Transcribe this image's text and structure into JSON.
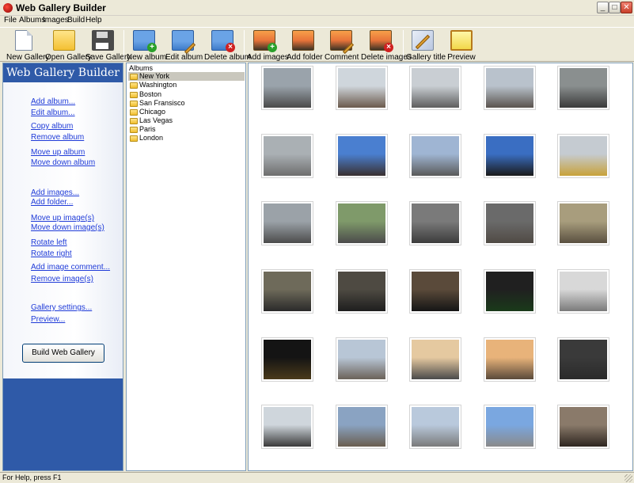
{
  "window": {
    "title": "Web Gallery Builder",
    "controls": [
      "_",
      "□",
      "✕"
    ]
  },
  "menu": [
    "File",
    "Albums",
    "Images",
    "Build",
    "Help"
  ],
  "toolbar": [
    {
      "label": "New Gallery",
      "icon": "new-document-icon"
    },
    {
      "label": "Open Gallery",
      "icon": "open-folder-icon"
    },
    {
      "label": "Save Gallery",
      "icon": "floppy-disk-icon"
    },
    {
      "label": "New album",
      "icon": "new-album-icon"
    },
    {
      "label": "Edit album",
      "icon": "edit-album-icon"
    },
    {
      "label": "Delete album",
      "icon": "delete-album-icon"
    },
    {
      "label": "Add images",
      "icon": "add-images-icon"
    },
    {
      "label": "Add folder",
      "icon": "add-folder-icon"
    },
    {
      "label": "Comment",
      "icon": "comment-icon"
    },
    {
      "label": "Delete images",
      "icon": "delete-images-icon"
    },
    {
      "label": "Gallery title",
      "icon": "gallery-title-icon"
    },
    {
      "label": "Preview",
      "icon": "preview-icon"
    }
  ],
  "sidebar": {
    "brand": "Web Gallery Builder",
    "links": [
      "Add album...",
      "Edit album...",
      "Copy album",
      "Remove album",
      "Move up album",
      "Move down album",
      "Add images...",
      "Add folder...",
      "Move up image(s)",
      "Move down image(s)",
      "Rotate left",
      "Rotate right",
      "Add image comment...",
      "Remove image(s)",
      "Gallery settings...",
      "Preview..."
    ],
    "build_button": "Build Web Gallery"
  },
  "albums": {
    "root": "Albums",
    "selected": "New York",
    "items": [
      "New York",
      "Washington",
      "Boston",
      "San Fransisco",
      "Chicago",
      "Las Vegas",
      "Paris",
      "London"
    ]
  },
  "thumbnails": [
    {
      "name": "photo-1",
      "top": "#9aa3ab",
      "bottom": "#4a4a4a"
    },
    {
      "name": "photo-2",
      "top": "#cfd6dc",
      "bottom": "#6b5a4c"
    },
    {
      "name": "photo-3",
      "top": "#c9ced3",
      "bottom": "#5e5e5e"
    },
    {
      "name": "photo-4",
      "top": "#b9c2cc",
      "bottom": "#5a534e"
    },
    {
      "name": "photo-5",
      "top": "#8a8f8f",
      "bottom": "#3a3a3a"
    },
    {
      "name": "photo-6",
      "top": "#aab0b4",
      "bottom": "#6e6e6e"
    },
    {
      "name": "photo-7",
      "top": "#4a7fd0",
      "bottom": "#3a3030"
    },
    {
      "name": "photo-8",
      "top": "#9fb5d3",
      "bottom": "#5a5a5a"
    },
    {
      "name": "photo-9",
      "top": "#3a6ec2",
      "bottom": "#1a1a1a"
    },
    {
      "name": "photo-10",
      "top": "#c5cbd1",
      "bottom": "#c8a23a"
    },
    {
      "name": "photo-11",
      "top": "#9ba2a8",
      "bottom": "#4c4c4c"
    },
    {
      "name": "photo-12",
      "top": "#7f9a6a",
      "bottom": "#4b4b4b"
    },
    {
      "name": "photo-13",
      "top": "#7a7a7a",
      "bottom": "#3c3c3c"
    },
    {
      "name": "photo-14",
      "top": "#6a6a6a",
      "bottom": "#504a44"
    },
    {
      "name": "photo-15",
      "top": "#a89d7d",
      "bottom": "#5a5040"
    },
    {
      "name": "photo-16",
      "top": "#6e6a5a",
      "bottom": "#2a2a2a"
    },
    {
      "name": "photo-17",
      "top": "#4e4a42",
      "bottom": "#1e1e1e"
    },
    {
      "name": "photo-18",
      "top": "#5a4a3a",
      "bottom": "#151515"
    },
    {
      "name": "photo-19",
      "top": "#202020",
      "bottom": "#1a3a1a"
    },
    {
      "name": "photo-20",
      "top": "#d8d8d8",
      "bottom": "#7a7a7a"
    },
    {
      "name": "photo-21",
      "top": "#141414",
      "bottom": "#4a3a1a"
    },
    {
      "name": "photo-22",
      "top": "#b8c6d6",
      "bottom": "#6b6259"
    },
    {
      "name": "photo-23",
      "top": "#e5c9a0",
      "bottom": "#4a4a4a"
    },
    {
      "name": "photo-24",
      "top": "#e8b37a",
      "bottom": "#5a4a3a"
    },
    {
      "name": "photo-25",
      "top": "#3a3a3a",
      "bottom": "#2a2a2a"
    },
    {
      "name": "photo-26",
      "top": "#cfd6dc",
      "bottom": "#3a3a3a"
    },
    {
      "name": "photo-27",
      "top": "#8aa3c2",
      "bottom": "#6a5e50"
    },
    {
      "name": "photo-28",
      "top": "#b9c9dc",
      "bottom": "#7a7a7a"
    },
    {
      "name": "photo-29",
      "top": "#7aa7e0",
      "bottom": "#8a8a8a"
    },
    {
      "name": "photo-30",
      "top": "#8a7a6a",
      "bottom": "#2e2620"
    }
  ],
  "status": "For Help, press F1"
}
